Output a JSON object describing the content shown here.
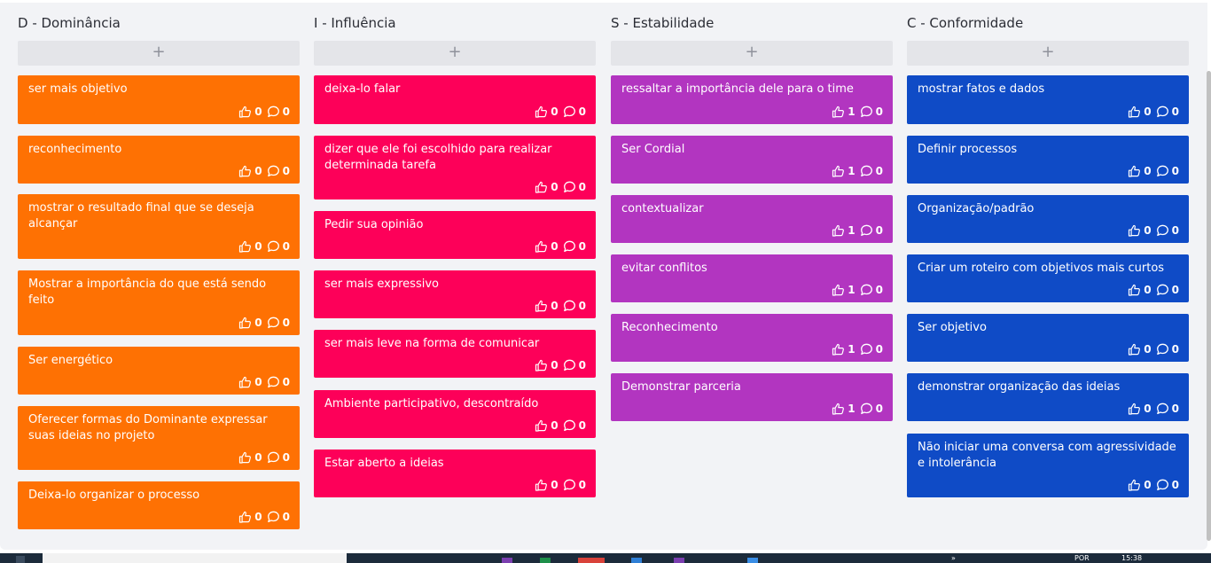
{
  "colors": {
    "board_bg": "#f2f3f6",
    "dominance": "#fe7103",
    "influence": "#fd0059",
    "stability": "#b235c0",
    "conformity": "#0f4bc6"
  },
  "add_label": "+",
  "icons": {
    "like": "thumbs-up-icon",
    "comment": "comment-bubble-icon"
  },
  "columns": [
    {
      "title": "D - Dominância",
      "cards": [
        {
          "text": "ser mais objetivo",
          "likes": "0",
          "comments": "0"
        },
        {
          "text": "reconhecimento",
          "likes": "0",
          "comments": "0"
        },
        {
          "text": "mostrar o resultado final que se deseja alcançar",
          "likes": "0",
          "comments": "0"
        },
        {
          "text": "Mostrar a importância do que está sendo feito",
          "likes": "0",
          "comments": "0"
        },
        {
          "text": "Ser energético",
          "likes": "0",
          "comments": "0"
        },
        {
          "text": "Oferecer formas do Dominante expressar suas ideias no projeto",
          "likes": "0",
          "comments": "0"
        },
        {
          "text": "Deixa-lo organizar o processo",
          "likes": "0",
          "comments": "0"
        }
      ]
    },
    {
      "title": "I - Influência",
      "cards": [
        {
          "text": "deixa-lo falar",
          "likes": "0",
          "comments": "0"
        },
        {
          "text": "dizer que ele foi escolhido para realizar determinada tarefa",
          "likes": "0",
          "comments": "0"
        },
        {
          "text": "Pedir sua opinião",
          "likes": "0",
          "comments": "0"
        },
        {
          "text": "ser mais expressivo",
          "likes": "0",
          "comments": "0"
        },
        {
          "text": "ser mais leve na forma de comunicar",
          "likes": "0",
          "comments": "0"
        },
        {
          "text": "Ambiente participativo, descontraído",
          "likes": "0",
          "comments": "0"
        },
        {
          "text": "Estar aberto a ideias",
          "likes": "0",
          "comments": "0"
        }
      ]
    },
    {
      "title": "S - Estabilidade",
      "cards": [
        {
          "text": "ressaltar a importância dele para o time",
          "likes": "1",
          "comments": "0"
        },
        {
          "text": "Ser Cordial",
          "likes": "1",
          "comments": "0"
        },
        {
          "text": "contextualizar",
          "likes": "1",
          "comments": "0"
        },
        {
          "text": "evitar conflitos",
          "likes": "1",
          "comments": "0"
        },
        {
          "text": "Reconhecimento",
          "likes": "1",
          "comments": "0"
        },
        {
          "text": "Demonstrar parceria",
          "likes": "1",
          "comments": "0"
        }
      ]
    },
    {
      "title": "C - Conformidade",
      "cards": [
        {
          "text": "mostrar fatos e dados",
          "likes": "0",
          "comments": "0"
        },
        {
          "text": "Definir processos",
          "likes": "0",
          "comments": "0"
        },
        {
          "text": "Organização/padrão",
          "likes": "0",
          "comments": "0"
        },
        {
          "text": "Criar um roteiro com objetivos mais curtos",
          "likes": "0",
          "comments": "0"
        },
        {
          "text": "Ser objetivo",
          "likes": "0",
          "comments": "0"
        },
        {
          "text": "demonstrar organização das ideias",
          "likes": "0",
          "comments": "0"
        },
        {
          "text": "Não iniciar uma conversa com agressividade e intolerância",
          "likes": "0",
          "comments": "0"
        }
      ]
    }
  ],
  "taskbar": {
    "overflow": "»",
    "lang": "POR",
    "time": "15:38"
  }
}
